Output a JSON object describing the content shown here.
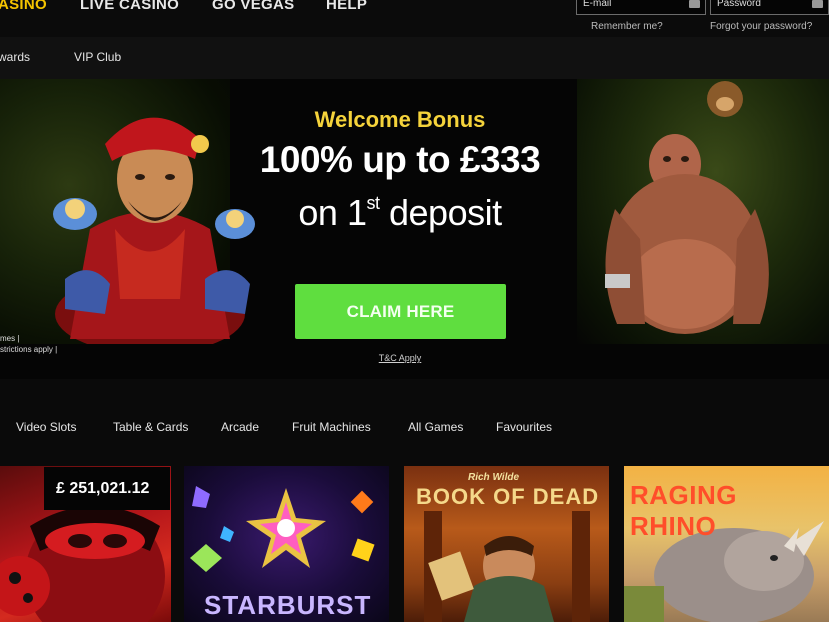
{
  "top_nav": {
    "items": [
      {
        "label": "ASINO"
      },
      {
        "label": "LIVE CASINO"
      },
      {
        "label": "GO VEGAS"
      },
      {
        "label": "HELP"
      }
    ]
  },
  "login": {
    "email_placeholder": "E-mail",
    "password_placeholder": "Password",
    "remember_label": "Remember me?",
    "forgot_label": "Forgot your password?"
  },
  "sub_nav": {
    "items": [
      {
        "label": "wards"
      },
      {
        "label": "VIP Club"
      }
    ]
  },
  "banner": {
    "welcome": "Welcome Bonus",
    "offer_line1": "100% up to £333",
    "offer_line2_pre": "on 1",
    "offer_line2_sup": "st",
    "offer_line2_post": " deposit",
    "claim_label": "CLAIM HERE",
    "tc_label": "T&C Apply",
    "fineprint_1": "mes |",
    "fineprint_2": "strictions apply |"
  },
  "categories": {
    "items": [
      {
        "label": "Video Slots"
      },
      {
        "label": "Table & Cards"
      },
      {
        "label": "Arcade"
      },
      {
        "label": "Fruit Machines"
      },
      {
        "label": "All Games"
      },
      {
        "label": "Favourites"
      }
    ]
  },
  "games": {
    "jackpot": "£ 251,021.12",
    "tiles": [
      {
        "title": ""
      },
      {
        "title": "STARBURST"
      },
      {
        "title": "BOOK OF DEAD",
        "subtitle": "Rich Wilde"
      },
      {
        "title": "RAGING RHINO"
      }
    ]
  },
  "colors": {
    "accent_yellow": "#f5c400",
    "welcome_yellow": "#f5d33b",
    "claim_green": "#5fde3f",
    "background": "#0a0a0a"
  }
}
